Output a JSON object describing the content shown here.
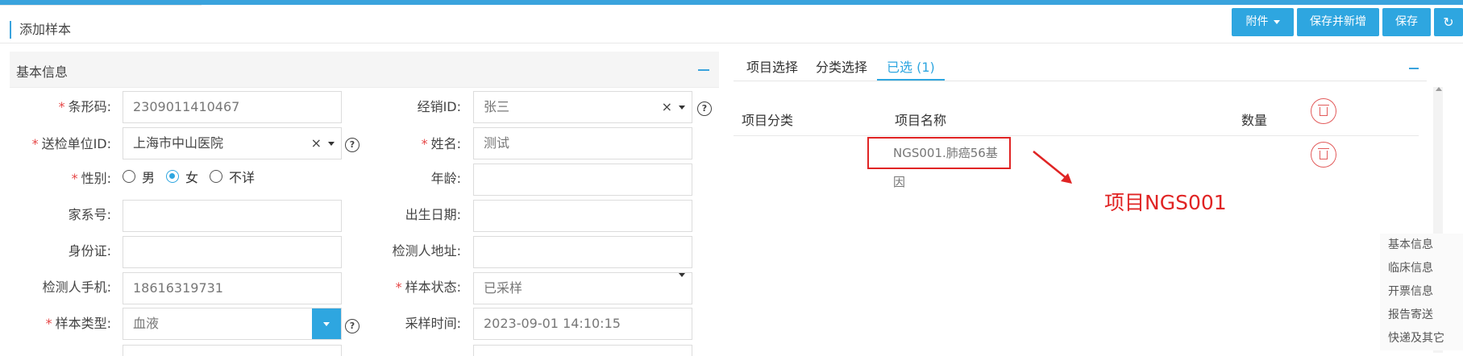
{
  "page": {
    "title": "添加样本"
  },
  "toolbar": {
    "attach": "附件",
    "save_new": "保存并新增",
    "save": "保存"
  },
  "basic_info": {
    "title": "基本信息",
    "fields": {
      "barcode": {
        "label": "条形码:",
        "value": "2309011410467",
        "required": true
      },
      "sales_id": {
        "label": "经销ID:",
        "value": "张三"
      },
      "unit": {
        "label": "送检单位ID:",
        "value": "上海市中山医院",
        "required": true
      },
      "name": {
        "label": "姓名:",
        "value": "测试",
        "required": true
      },
      "gender": {
        "label": "性别:",
        "options": [
          "男",
          "女",
          "不详"
        ],
        "selected": "女",
        "required": true
      },
      "age": {
        "label": "年龄:",
        "value": ""
      },
      "family": {
        "label": "家系号:",
        "value": ""
      },
      "birth": {
        "label": "出生日期:",
        "value": ""
      },
      "idcard": {
        "label": "身份证:",
        "value": ""
      },
      "address": {
        "label": "检测人地址:",
        "value": ""
      },
      "phone": {
        "label": "检测人手机:",
        "value": "18616319731"
      },
      "status": {
        "label": "样本状态:",
        "value": "已采样",
        "required": true
      },
      "type": {
        "label": "样本类型:",
        "value": "血液",
        "required": true
      },
      "sample_time": {
        "label": "采样时间:",
        "value": "2023-09-01 14:10:15"
      }
    }
  },
  "right": {
    "tabs": [
      "项目选择",
      "分类选择",
      "已选 (1)"
    ],
    "active_tab": 2,
    "columns": [
      "项目分类",
      "项目名称",
      "数量"
    ],
    "rows": [
      {
        "category": "",
        "name": "NGS001.肺癌56基因",
        "qty": ""
      }
    ],
    "annotation": "项目NGS001"
  },
  "side_nav": [
    "基本信息",
    "临床信息",
    "开票信息",
    "报告寄送",
    "快递及其它"
  ]
}
